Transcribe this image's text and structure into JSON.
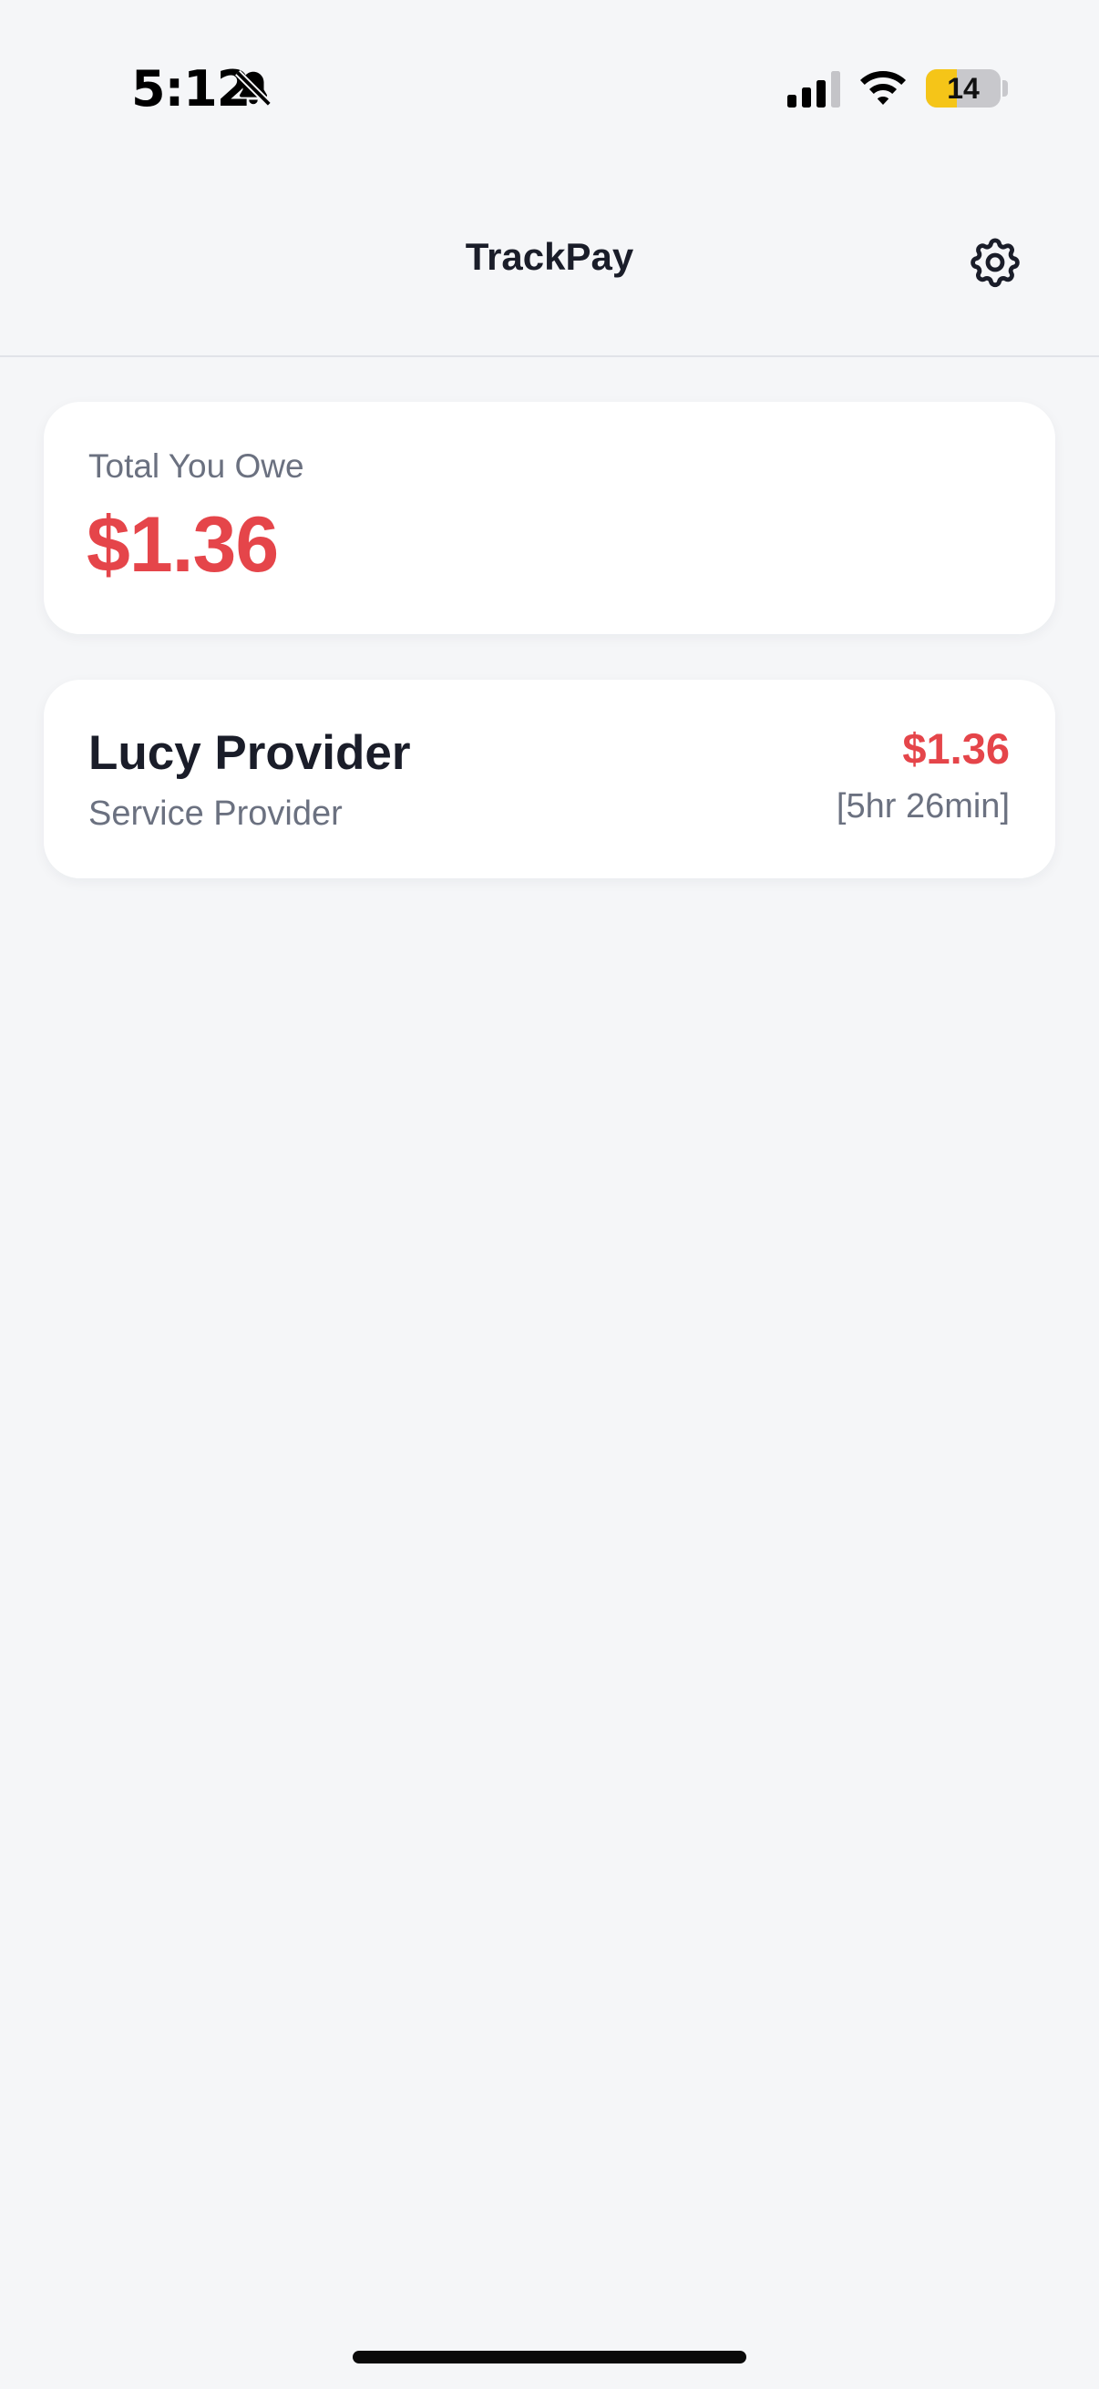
{
  "status_bar": {
    "time": "5:12",
    "battery_level": "14",
    "battery_fraction": 0.42,
    "icons": [
      "bell-slash-icon",
      "cellular-signal-icon",
      "wifi-icon",
      "battery-icon"
    ]
  },
  "header": {
    "title": "TrackPay",
    "settings_icon": "gear-icon"
  },
  "summary": {
    "label": "Total You Owe",
    "amount": "$1.36"
  },
  "providers": [
    {
      "name": "Lucy Provider",
      "role": "Service Provider",
      "amount": "$1.36",
      "duration": "[5hr 26min]"
    }
  ],
  "colors": {
    "background": "#f5f6f8",
    "card": "#ffffff",
    "owed_red": "#e5454a",
    "text_primary": "#1a1d29",
    "text_secondary": "#6b7180",
    "battery_low": "#f5c518"
  }
}
